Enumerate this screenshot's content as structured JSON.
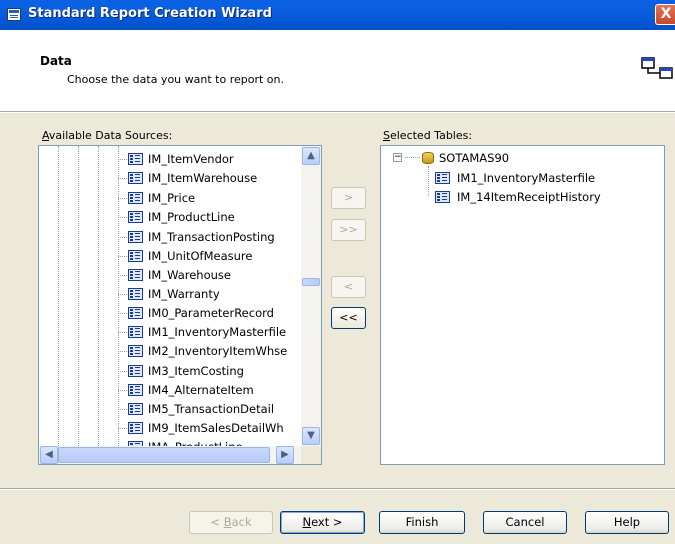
{
  "window": {
    "title": "Standard Report Creation Wizard",
    "close_glyph": "X"
  },
  "header": {
    "title": "Data",
    "subtitle": "Choose the data you want to report on."
  },
  "available": {
    "label_prefix": "",
    "label_accel": "A",
    "label_rest": "vailable Data Sources:",
    "items": [
      "IM_ItemVendor",
      "IM_ItemWarehouse",
      "IM_Price",
      "IM_ProductLine",
      "IM_TransactionPosting",
      "IM_UnitOfMeasure",
      "IM_Warehouse",
      "IM_Warranty",
      "IM0_ParameterRecord",
      "IM1_InventoryMasterfile",
      "IM2_InventoryItemWhse",
      "IM3_ItemCosting",
      "IM4_AlternateItem",
      "IM5_TransactionDetail",
      "IM9_ItemSalesDetailWh",
      "IMA_ProductLine"
    ]
  },
  "selected": {
    "label_accel": "S",
    "label_rest": "elected Tables:",
    "root": "SOTAMAS90",
    "items": [
      "IM1_InventoryMasterfile",
      "IM_14ItemReceiptHistory"
    ]
  },
  "transfer": {
    "add_one": ">",
    "add_all": ">>",
    "remove_one": "<",
    "remove_all": "<<"
  },
  "buttons": {
    "back_prefix": "< ",
    "back_accel": "B",
    "back_rest": "ack",
    "next_accel": "N",
    "next_rest": "ext >",
    "finish": "Finish",
    "cancel": "Cancel",
    "help": "Help"
  },
  "icons": {
    "up": "▲",
    "down": "▼",
    "left": "◀",
    "right": "▶",
    "expand": "−"
  }
}
